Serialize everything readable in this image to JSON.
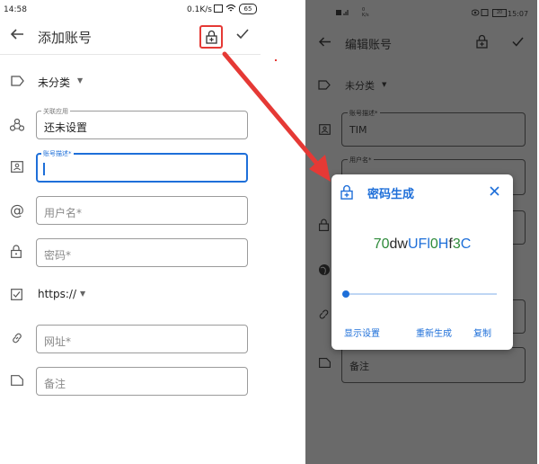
{
  "left": {
    "status": {
      "time": "14:58",
      "net_speed": "0.1K/s",
      "battery": "65"
    },
    "toolbar": {
      "title": "添加账号"
    },
    "category": {
      "value": "未分类"
    },
    "linked_app": {
      "label": "关联应用",
      "value": "还未设置"
    },
    "description": {
      "label": "账号描述*",
      "value": ""
    },
    "username": {
      "placeholder": "用户名*"
    },
    "password": {
      "placeholder": "密码*"
    },
    "scheme": {
      "value": "https://"
    },
    "url": {
      "placeholder": "网址*"
    },
    "note": {
      "placeholder": "备注"
    }
  },
  "right": {
    "status": {
      "battery": "20",
      "time": "15:07",
      "net": "0\nK/s"
    },
    "toolbar": {
      "title": "编辑账号"
    },
    "category": {
      "value": "未分类"
    },
    "description": {
      "label": "账号描述*",
      "value": "TIM"
    },
    "username": {
      "label": "用户名*"
    },
    "note": {
      "value": "备注"
    }
  },
  "dialog": {
    "title": "密码生成",
    "password_parts": [
      {
        "t": "7",
        "c": "green"
      },
      {
        "t": "0",
        "c": "green"
      },
      {
        "t": "dw",
        "c": "dark"
      },
      {
        "t": "U",
        "c": "blue"
      },
      {
        "t": "F",
        "c": "blue"
      },
      {
        "t": "l",
        "c": "blue"
      },
      {
        "t": "0",
        "c": "green"
      },
      {
        "t": "H",
        "c": "blue"
      },
      {
        "t": "f",
        "c": "dark"
      },
      {
        "t": "3",
        "c": "green"
      },
      {
        "t": "C",
        "c": "blue"
      }
    ],
    "slider_level": 0.0,
    "show_settings": "显示设置",
    "regenerate": "重新生成",
    "copy": "复制"
  },
  "colors": {
    "accent": "#1e6fd9",
    "highlight": "#e53935",
    "overlay": "#6a6a6a"
  }
}
